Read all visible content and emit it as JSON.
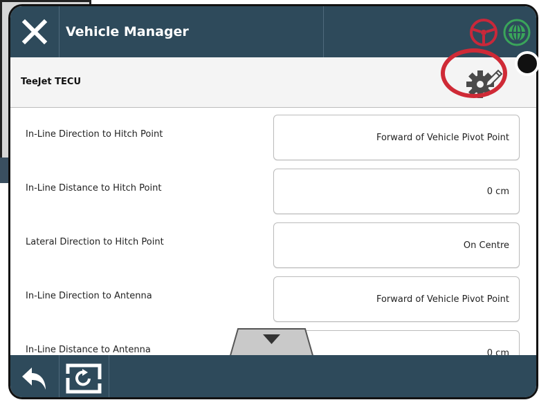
{
  "header": {
    "title": "Vehicle Manager"
  },
  "subheader": {
    "title": "TeeJet TECU"
  },
  "settings": [
    {
      "label": "In-Line Direction to Hitch Point",
      "value": "Forward of Vehicle Pivot Point"
    },
    {
      "label": "In-Line Distance to Hitch Point",
      "value": "0 cm"
    },
    {
      "label": "Lateral Direction to Hitch Point",
      "value": "On Centre"
    },
    {
      "label": "In-Line Direction to Antenna",
      "value": "Forward of Vehicle Pivot Point"
    },
    {
      "label": "In-Line Distance to Antenna",
      "value": "0 cm"
    }
  ],
  "icons": {
    "close": "close-icon",
    "steering": "steering-wheel-icon",
    "gnss": "gnss-icon",
    "edit_settings": "gear-pencil-icon",
    "scroll_down": "chevron-down-icon",
    "back": "back-arrow-icon",
    "reset": "reset-icon"
  },
  "colors": {
    "header_bg": "#2e4a5b",
    "highlight": "#cf2a36",
    "steering_icon": "#c8283a",
    "gnss_icon": "#3aa55a"
  }
}
